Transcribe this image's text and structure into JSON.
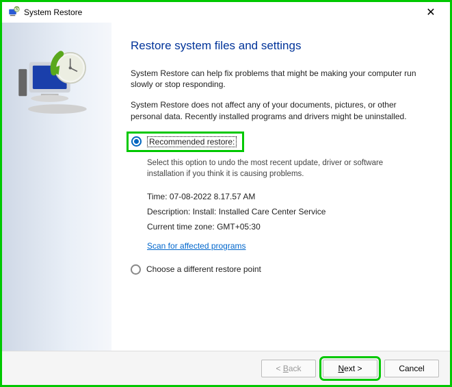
{
  "window": {
    "title": "System Restore"
  },
  "header": "Restore system files and settings",
  "intro1": "System Restore can help fix problems that might be making your computer run slowly or stop responding.",
  "intro2": "System Restore does not affect any of your documents, pictures, or other personal data. Recently installed programs and drivers might be uninstalled.",
  "options": {
    "recommended": {
      "label": "Recommended restore:",
      "detail": "Select this option to undo the most recent update, driver or software installation if you think it is causing problems.",
      "time_label": "Time:",
      "time_value": "07-08-2022 8.17.57 AM",
      "desc_label": "Description:",
      "desc_value": "Install: Installed Care Center Service",
      "tz_label": "Current time zone:",
      "tz_value": "GMT+05:30",
      "scan_link": "Scan for affected programs"
    },
    "different": {
      "label": "Choose a different restore point"
    }
  },
  "buttons": {
    "back": "< Back",
    "next": "Next >",
    "cancel": "Cancel"
  }
}
